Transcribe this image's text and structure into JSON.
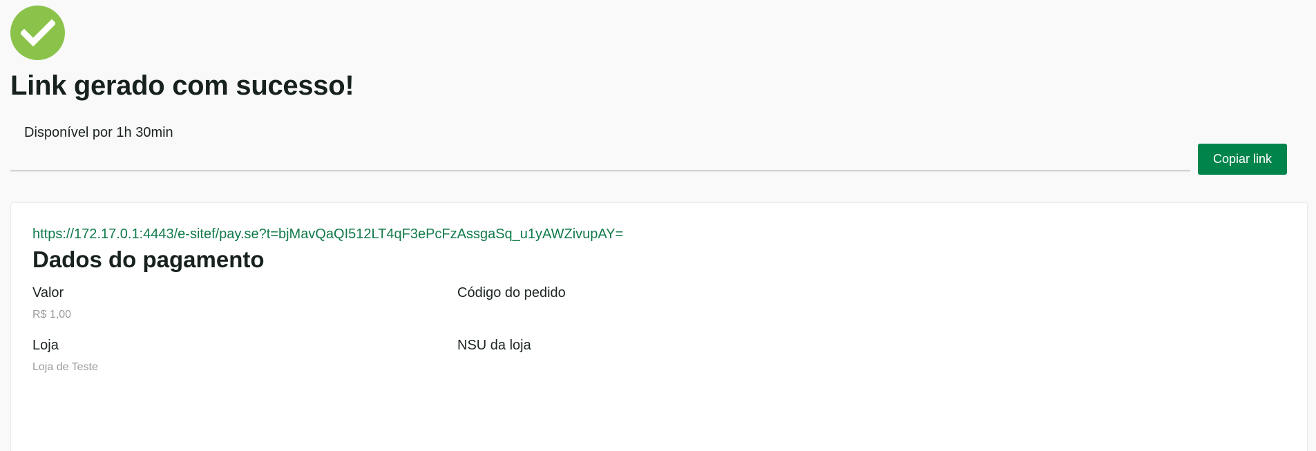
{
  "status": {
    "icon": "check-circle-icon",
    "accent_color": "#8bc34a",
    "title": "Link gerado com sucesso!",
    "availability": "Disponível por 1h 30min"
  },
  "link_field": {
    "value": ""
  },
  "copy_button": {
    "label": "Copiar link",
    "color": "#00844b"
  },
  "card": {
    "url": "https://172.17.0.1:4443/e-sitef/pay.se?t=bjMavQaQI512LT4qF3ePcFzAssgaSq_u1yAWZivupAY=",
    "section_title": "Dados do pagamento",
    "fields": {
      "valor": {
        "label": "Valor",
        "value": "R$ 1,00"
      },
      "codigo_pedido": {
        "label": "Código do pedido",
        "value": ""
      },
      "loja": {
        "label": "Loja",
        "value": "Loja de Teste"
      },
      "nsu_loja": {
        "label": "NSU da loja",
        "value": ""
      }
    }
  }
}
